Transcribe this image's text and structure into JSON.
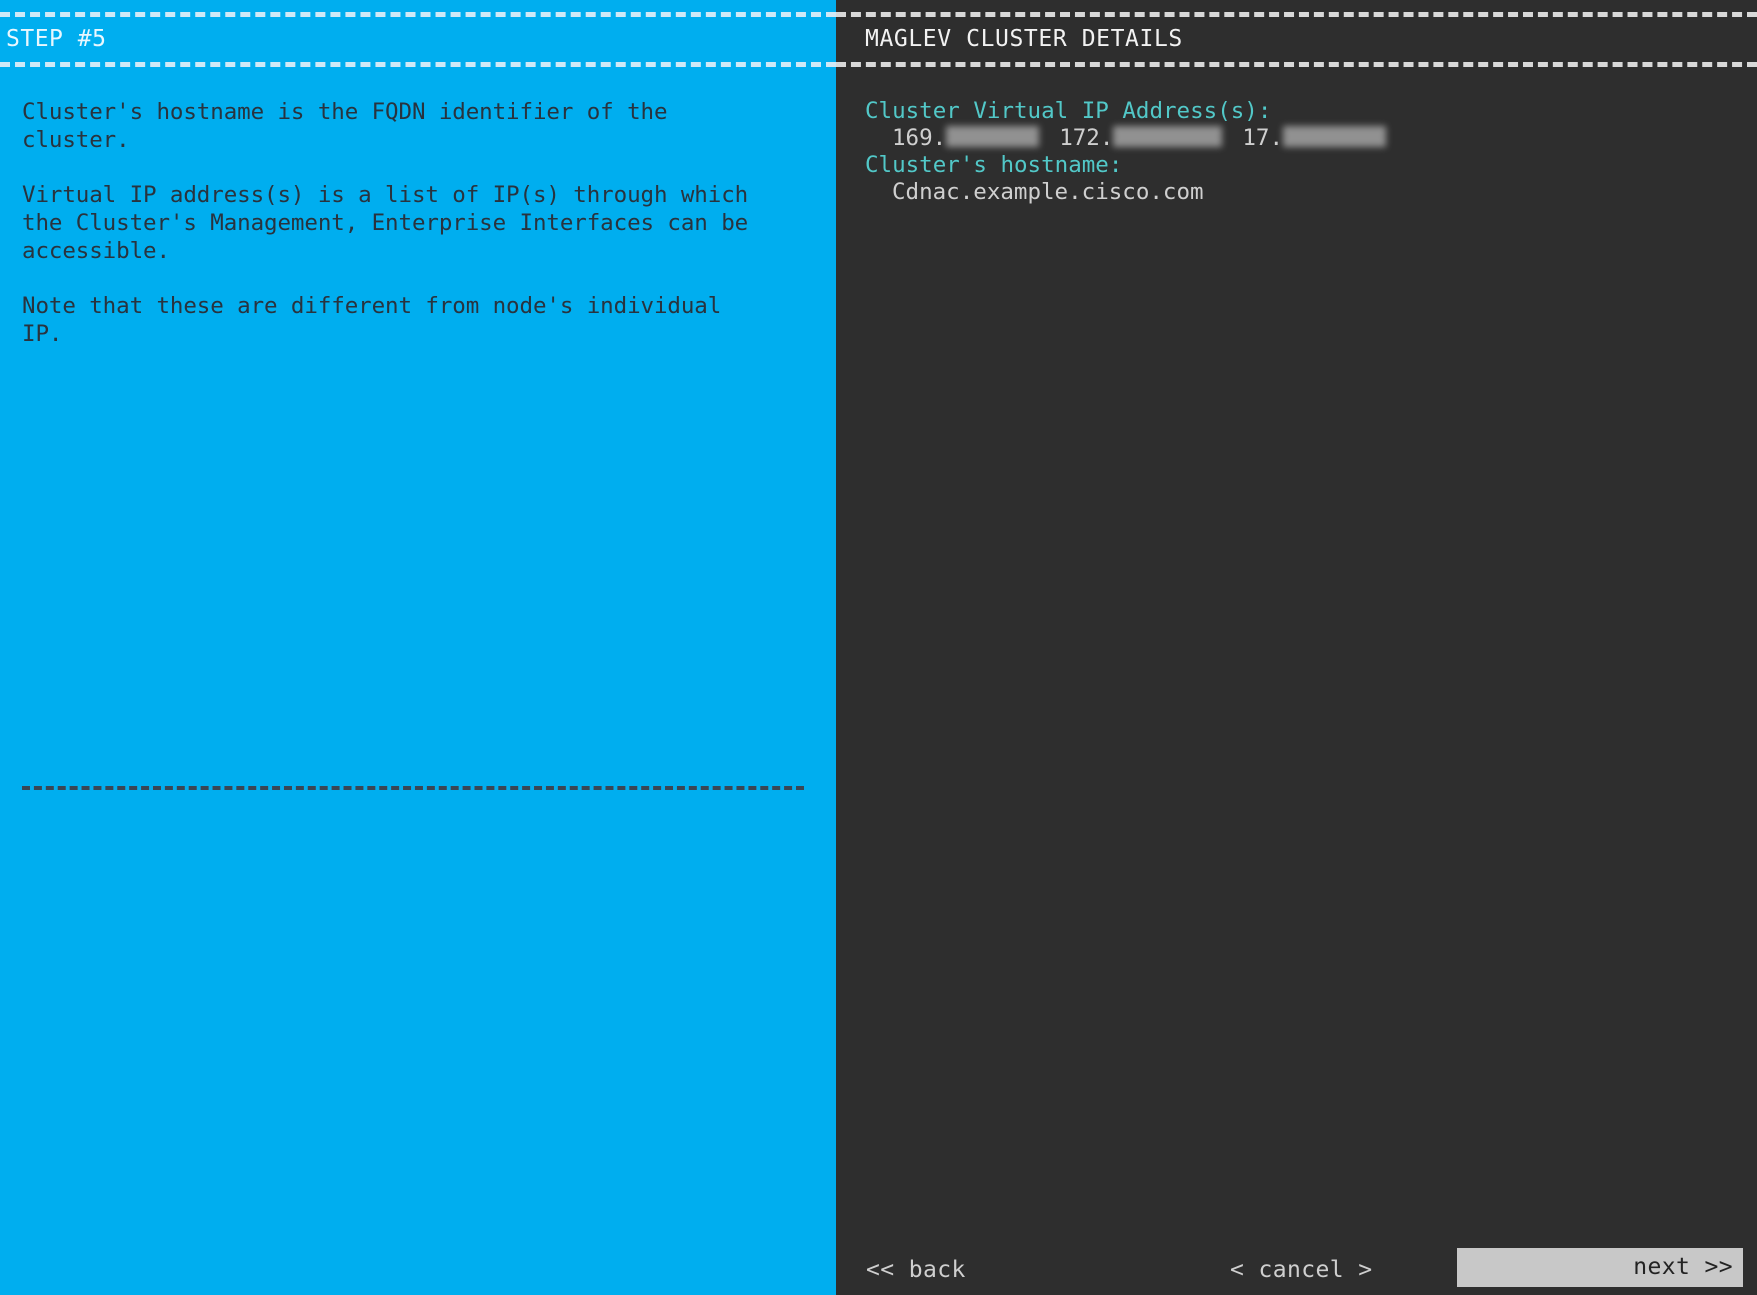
{
  "left_panel": {
    "step_title": "STEP #5",
    "paragraphs": [
      "Cluster's hostname is the FQDN identifier of the\ncluster.",
      "Virtual IP address(s) is a list of IP(s) through which\nthe Cluster's Management, Enterprise Interfaces can be\naccessible.",
      "Note that these are different from node's individual\nIP."
    ],
    "background_color": "#00aeef",
    "text_color": "#29333e"
  },
  "right_panel": {
    "title": "MAGLEV CLUSTER DETAILS",
    "background_color": "#2e2e2e",
    "label_color": "#52c8c8",
    "value_color": "#cfcfcf",
    "fields": [
      {
        "label": "Cluster Virtual IP Address(s):",
        "ip_addresses": [
          {
            "visible_prefix": "169.",
            "redacted": true
          },
          {
            "visible_prefix": "172.",
            "redacted": true
          },
          {
            "visible_prefix": "17.",
            "redacted": true
          }
        ]
      },
      {
        "label": "Cluster's hostname:",
        "value": "Cdnac.example.cisco.com"
      }
    ]
  },
  "footer": {
    "back_label": "<< back",
    "cancel_label": "< cancel >",
    "next_label": "next >>",
    "next_highlight_color": "#c8c8c8"
  }
}
